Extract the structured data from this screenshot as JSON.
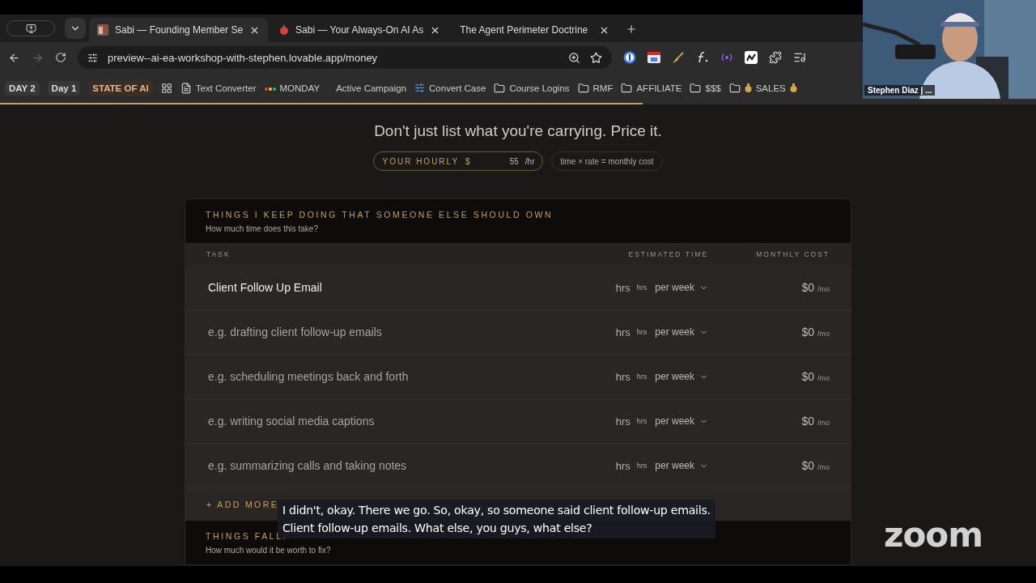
{
  "browser": {
    "tabs": [
      {
        "title": "Sabi — Founding Member Se",
        "selected": true
      },
      {
        "title": "Sabi — Your Always-On AI As",
        "selected": false,
        "kind": "tomato"
      },
      {
        "title": "The Agent Perimeter Doctrine",
        "selected": false,
        "kind": "plain"
      }
    ],
    "url": "preview--ai-ea-workshop-with-stephen.lovable.app/money",
    "bookmarks": [
      {
        "kind": "chip",
        "label": "DAY 2"
      },
      {
        "kind": "chip",
        "label": "Day 1"
      },
      {
        "kind": "chip-accent",
        "label": "STATE OF AI"
      },
      {
        "kind": "apps"
      },
      {
        "kind": "page",
        "label": "Text Converter"
      },
      {
        "kind": "monday",
        "label": "MONDAY"
      },
      {
        "kind": "plain",
        "label": "Active Campaign"
      },
      {
        "kind": "convert",
        "label": "Convert Case"
      },
      {
        "kind": "folder",
        "label": "Course Logins"
      },
      {
        "kind": "folder",
        "label": "RMF"
      },
      {
        "kind": "folder",
        "label": "AFFILIATE"
      },
      {
        "kind": "folder",
        "label": "$$$"
      },
      {
        "kind": "folder-money",
        "label": "SALES"
      }
    ],
    "loading_bar": {
      "level": 0.62
    }
  },
  "page": {
    "headline": "Don't just list what you're carrying. Price it.",
    "rate_field": {
      "label": "YOUR HOURLY",
      "currency": "$",
      "value": "55",
      "unit": "/hr"
    },
    "formula": "time × rate = monthly cost",
    "section": {
      "title": "THINGS I KEEP DOING THAT SOMEONE ELSE SHOULD OWN",
      "subtitle": "How much time does this take?",
      "columns": [
        "TASK",
        "ESTIMATED TIME",
        "MONTHLY COST"
      ],
      "rows": [
        {
          "task_value": "Client Follow Up Email",
          "hours_placeholder": "hrs",
          "unit": "hrs",
          "period": "per week",
          "cost": "$0",
          "per": "/mo"
        },
        {
          "task_placeholder": "e.g. drafting client follow-up emails",
          "hours_placeholder": "hrs",
          "unit": "hrs",
          "period": "per week",
          "cost": "$0",
          "per": "/mo"
        },
        {
          "task_placeholder": "e.g. scheduling meetings back and forth",
          "hours_placeholder": "hrs",
          "unit": "hrs",
          "period": "per week",
          "cost": "$0",
          "per": "/mo"
        },
        {
          "task_placeholder": "e.g. writing social media captions",
          "hours_placeholder": "hrs",
          "unit": "hrs",
          "period": "per week",
          "cost": "$0",
          "per": "/mo"
        },
        {
          "task_placeholder": "e.g. summarizing calls and taking notes",
          "hours_placeholder": "hrs",
          "unit": "hrs",
          "period": "per week",
          "cost": "$0",
          "per": "/mo"
        }
      ],
      "add_more": "+ ADD MORE"
    },
    "next_section": {
      "title": "THINGS FALLI",
      "subtitle": "How much would it be worth to fix?"
    }
  },
  "meeting": {
    "participant_name": "Stephen Diaz | ...",
    "caption": [
      "I didn't, okay. There we go. So, okay, so someone said client follow-up emails.",
      "Client follow-up emails. What else, you guys, what else?"
    ],
    "logo": "zoom"
  }
}
